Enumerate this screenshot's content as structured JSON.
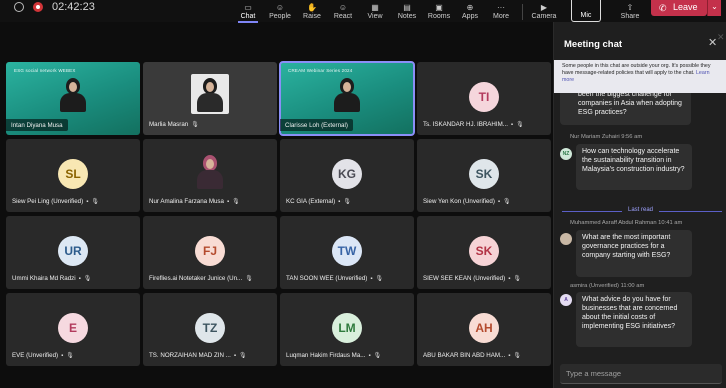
{
  "topbar": {
    "time": "02:42:23",
    "chat": "Chat",
    "people": "People",
    "raise": "Raise",
    "react": "React",
    "view": "View",
    "notes": "Notes",
    "rooms": "Rooms",
    "apps": "Apps",
    "more": "More",
    "camera": "Camera",
    "mic": "Mic",
    "share": "Share",
    "leave": "Leave"
  },
  "tiles": [
    {
      "name": "Intan Diyana Musa",
      "banner": "ESG social network WEBEX"
    },
    {
      "name": "Marlia Masran"
    },
    {
      "name": "Clarisse Loh (External)",
      "banner": "CREAM Webinar Series 2024"
    },
    {
      "name": "Ts. ISKANDAR HJ. IBRAHIM...",
      "initials": "TI"
    },
    {
      "name": "Siew Pei Ling (Unverified)",
      "initials": "SL"
    },
    {
      "name": "Nur Amalina Farzana Musa"
    },
    {
      "name": "KC GIA (External)",
      "initials": "KG"
    },
    {
      "name": "Siew Yen Kon (Unverified)",
      "initials": "SK"
    },
    {
      "name": "Ummi Khaira Md Radzi",
      "initials": "UR"
    },
    {
      "name": "Fireflies.ai Notetaker Junice (Un...",
      "initials": "FJ"
    },
    {
      "name": "TAN SOON WEE (Unverified)",
      "initials": "TW"
    },
    {
      "name": "SIEW SEE KEAN (Unverified)",
      "initials": "SK"
    },
    {
      "name": "EVE (Unverified)",
      "initials": "E"
    },
    {
      "name": "TS. NORZAIHAN MAD ZIN ...",
      "initials": "TZ"
    },
    {
      "name": "Luqman Hakim Firdaus Ma...",
      "initials": "LM"
    },
    {
      "name": "ABU BAKAR BIN ABD HAM...",
      "initials": "AH"
    }
  ],
  "chat": {
    "title": "Meeting chat",
    "notice": "Some people in this chat are outside your org. It's possible they have message-related policies that will apply to the chat.",
    "learn_more": "Learn more",
    "msg1_text": "been the biggest challenge for companies in Asia when adopting ESG practices?",
    "msg2_meta": "Nur Mariam Zuhairi  9:56 am",
    "msg2_av": "NZ",
    "msg2_text": "How can technology accelerate the sustainability transition in Malaysia's construction industry?",
    "last_read": "Last read",
    "msg3_meta": "Muhammed Asraff Abdul Rahman  10:41 am",
    "msg3_text": "What are the most important governance practices for a company starting with ESG?",
    "msg4_meta": "asmira (Unverified)  11:00 am",
    "msg4_av": "A",
    "msg4_text": "What advice do you have for businesses that are concerned about the initial costs of implementing ESG initiatives?",
    "compose_placeholder": "Type a message"
  },
  "colors": {
    "accent": "#7f85f5",
    "leave": "#c4314b"
  }
}
